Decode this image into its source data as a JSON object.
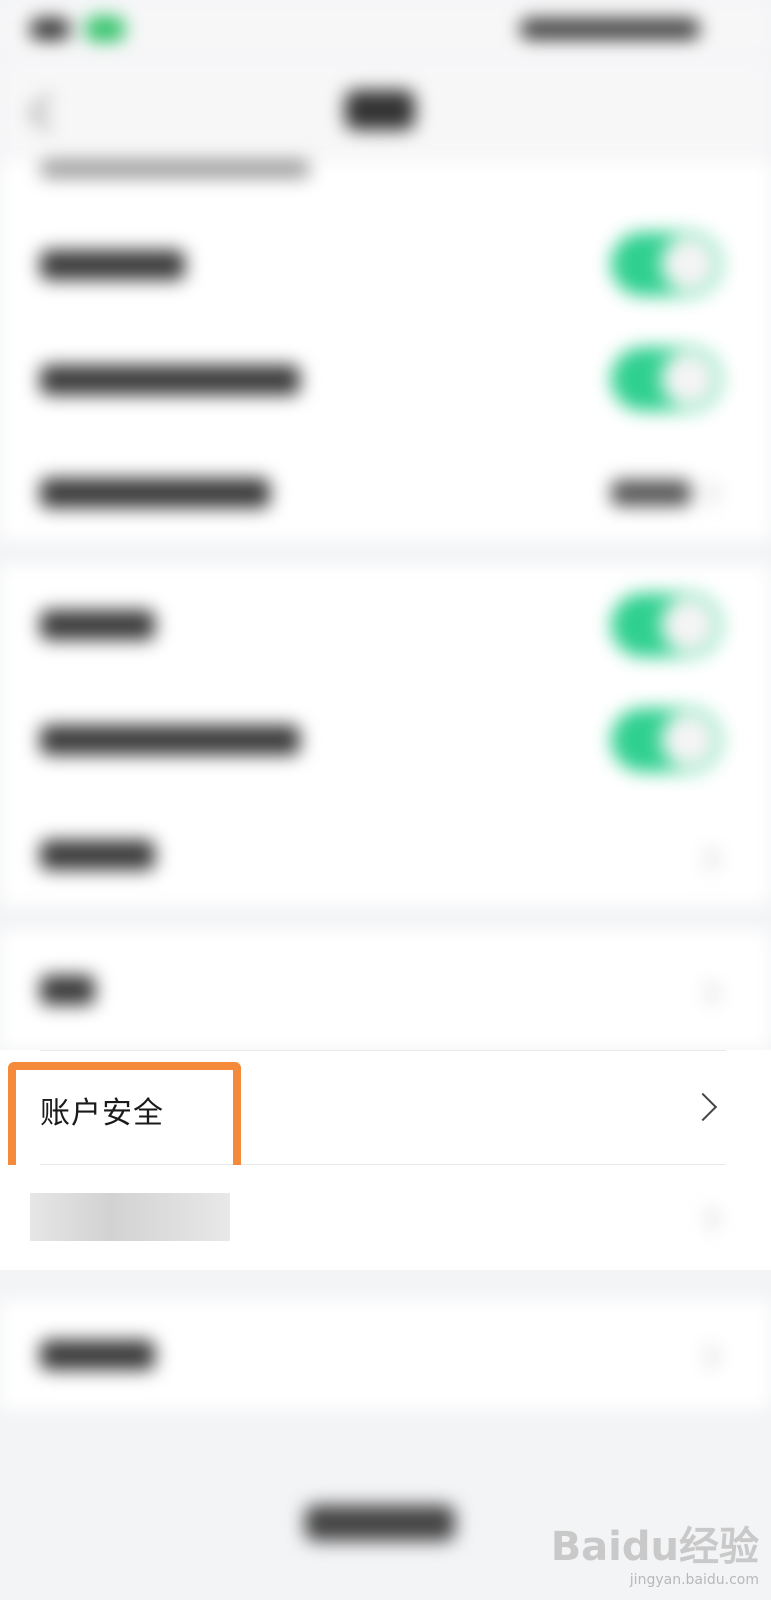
{
  "account_security": {
    "label": "账户安全"
  },
  "watermark": {
    "brand": "Baidu经验",
    "url": "jingyan.baidu.com"
  },
  "colors": {
    "toggle_on": "#2fd08f",
    "highlight": "#f58a3a",
    "background": "#f3f4f6"
  },
  "icons": {
    "back": "back-arrow-icon",
    "chevron": "chevron-right-icon"
  },
  "toggles": [
    {
      "state": "on"
    },
    {
      "state": "on"
    },
    {
      "state": "on"
    },
    {
      "state": "on"
    }
  ]
}
